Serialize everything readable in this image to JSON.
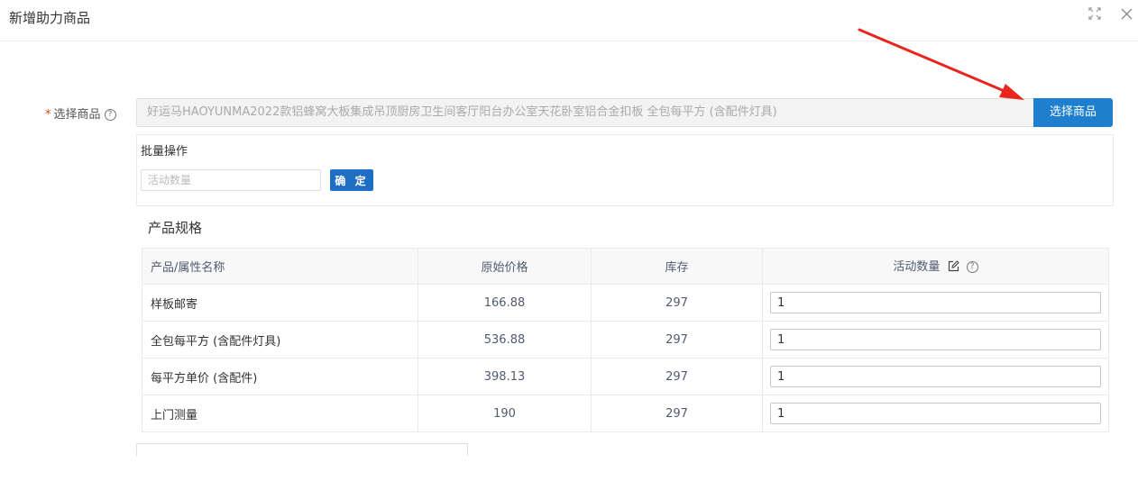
{
  "dialog": {
    "title": "新增助力商品"
  },
  "form": {
    "required_mark": "*",
    "product_label": "选择商品",
    "help_mark": "?",
    "product_value": "好运马HAOYUNMA2022款铝蜂窝大板集成吊顶厨房卫生间客厅阳台办公室天花卧室铝合金扣板 全包每平方 (含配件灯具)",
    "select_button": "选择商品"
  },
  "batch": {
    "title": "批量操作",
    "quantity_placeholder": "活动数量",
    "confirm_button": "确 定"
  },
  "spec": {
    "title": "产品规格",
    "headers": {
      "name": "产品/属性名称",
      "price": "原始价格",
      "stock": "库存",
      "quantity": "活动数量"
    },
    "rows": [
      {
        "name": "样板邮寄",
        "price": "166.88",
        "stock": "297",
        "quantity": "1"
      },
      {
        "name": "全包每平方 (含配件灯具)",
        "price": "536.88",
        "stock": "297",
        "quantity": "1"
      },
      {
        "name": "每平方单价 (含配件)",
        "price": "398.13",
        "stock": "297",
        "quantity": "1"
      },
      {
        "name": "上门测量",
        "price": "190",
        "stock": "297",
        "quantity": "1"
      }
    ]
  },
  "icons": {
    "fullscreen": "fullscreen-icon",
    "close": "close-icon",
    "edit": "edit-icon",
    "help": "question-circle-icon"
  },
  "colors": {
    "primary": "#1e7fcf",
    "required": "#ed4014",
    "annotation_arrow": "#e8261d"
  }
}
